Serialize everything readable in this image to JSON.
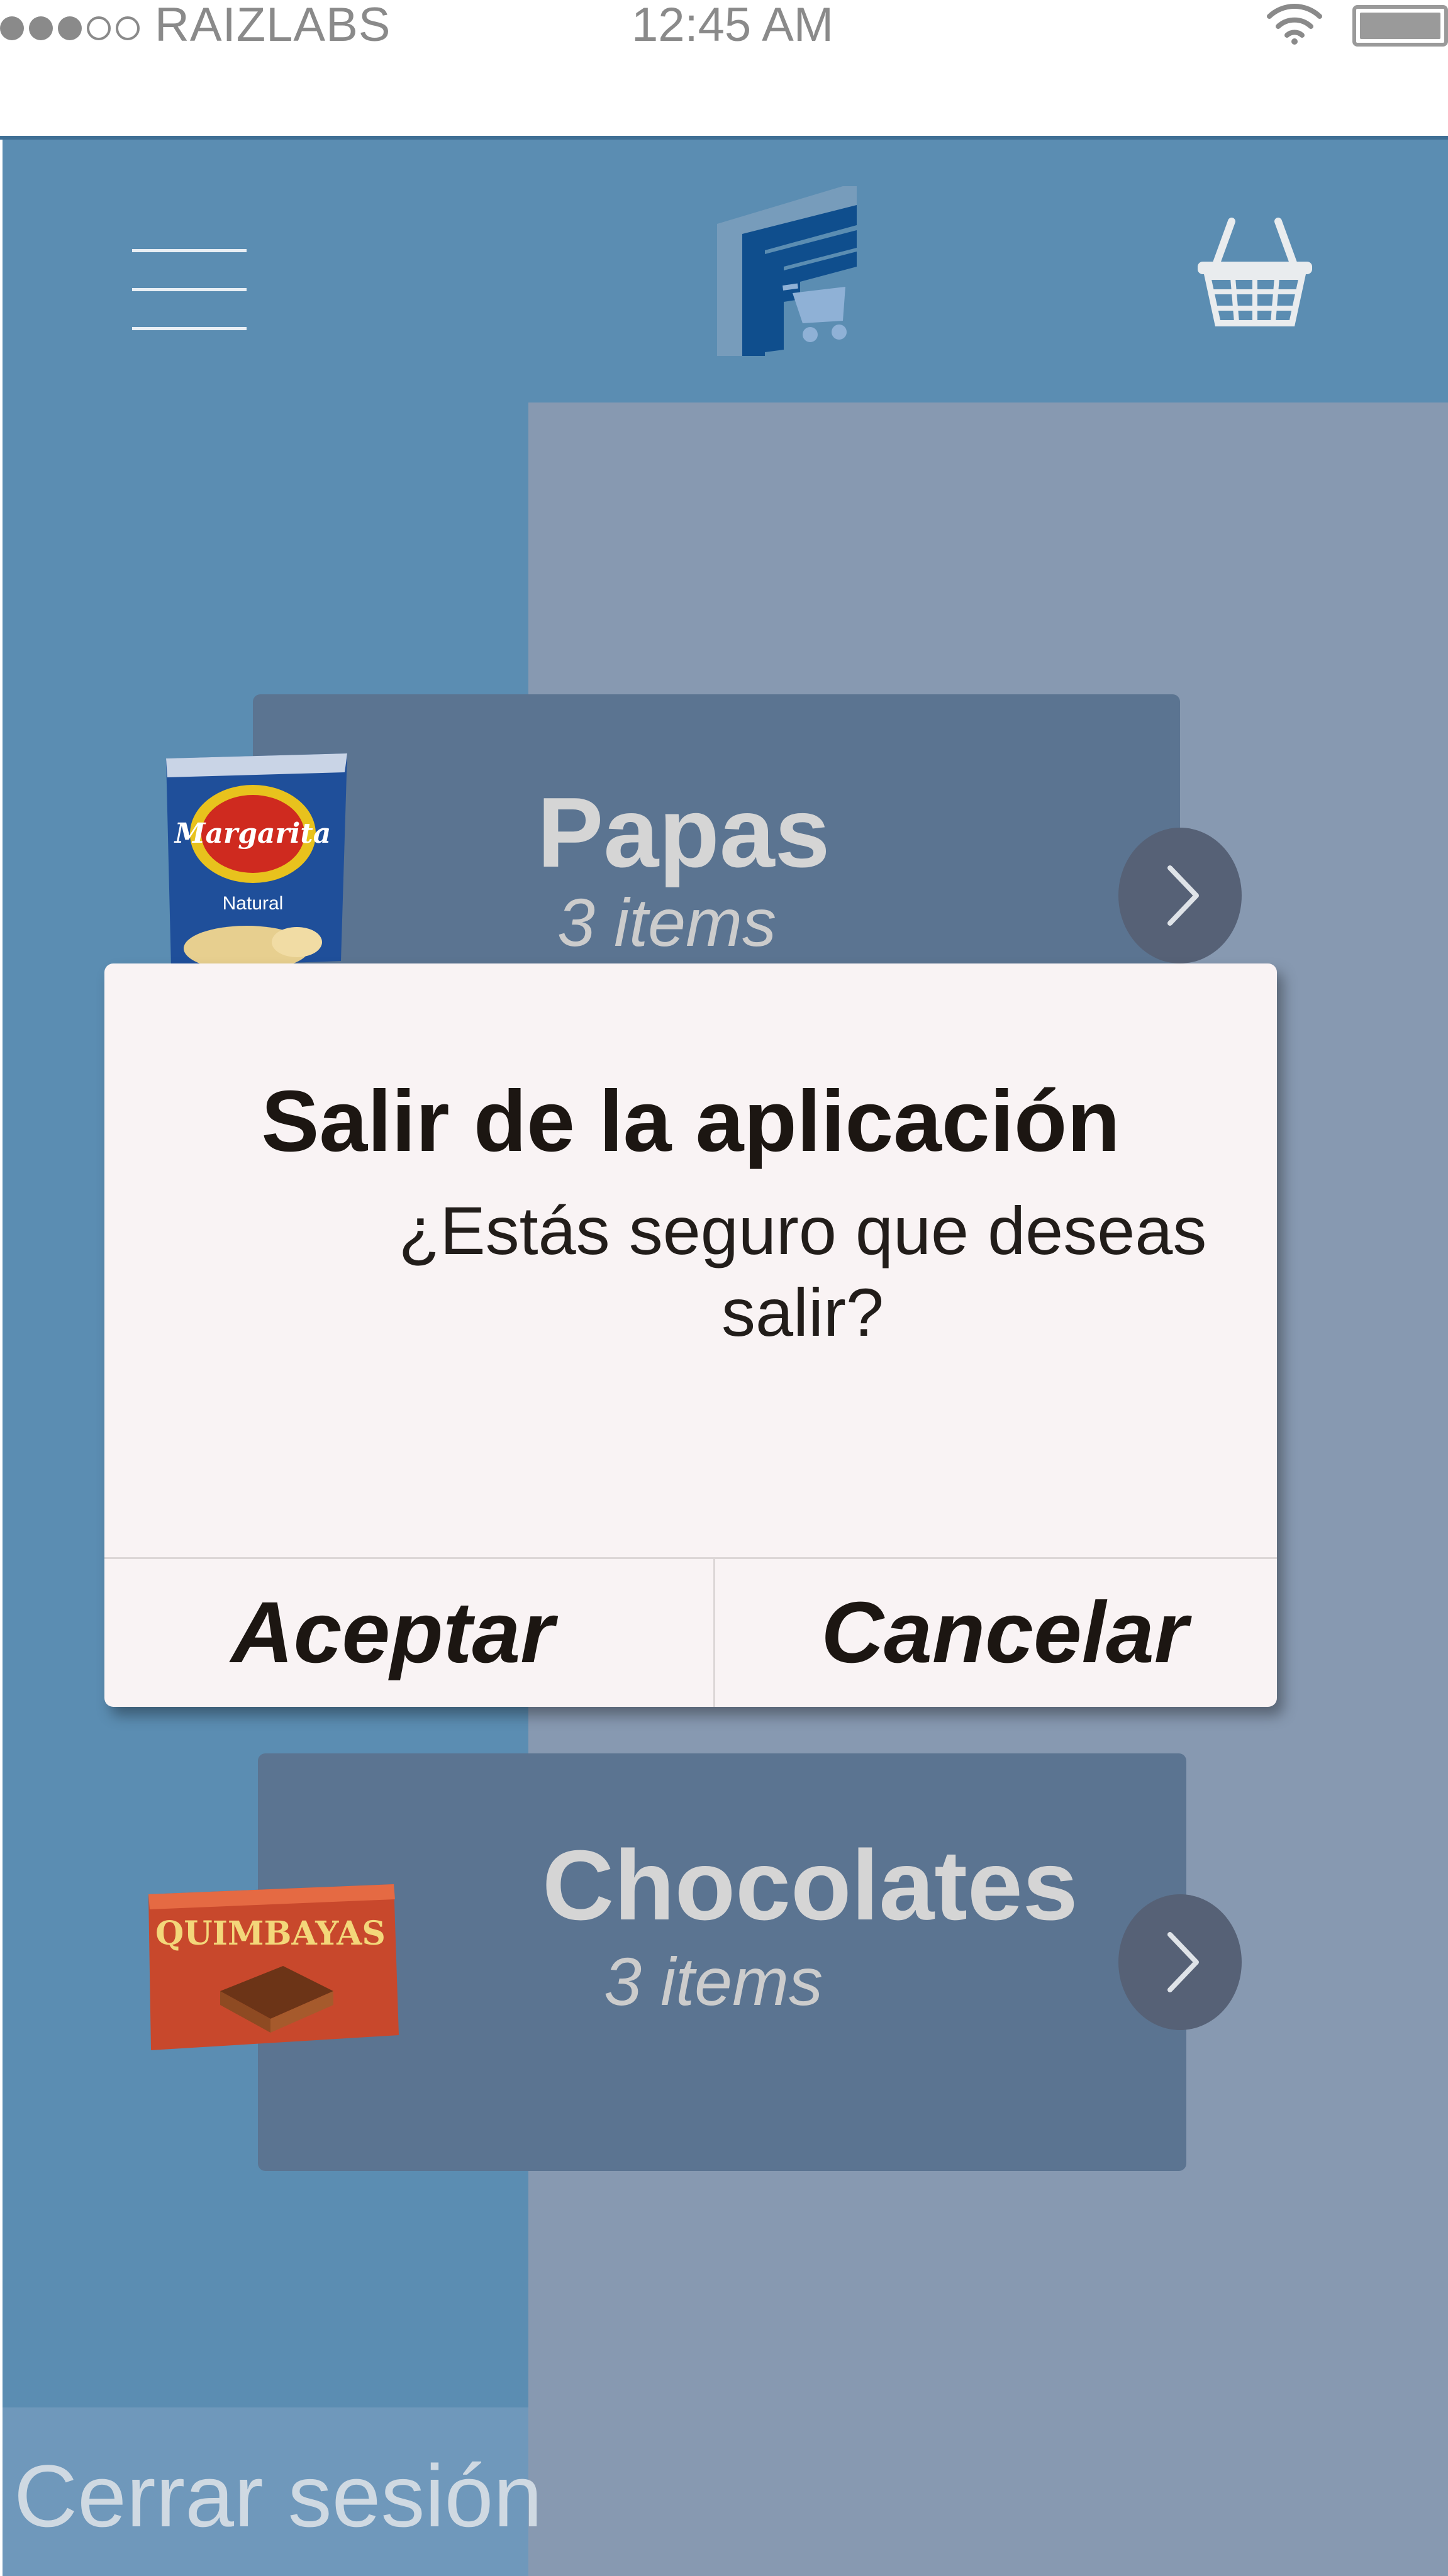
{
  "status_bar": {
    "carrier": "RAIZLABS",
    "time": "12:45 AM",
    "signal_icon": "signal-dots",
    "wifi_icon": "wifi-icon",
    "battery_icon": "battery-icon"
  },
  "header": {
    "menu_icon": "hamburger-menu-icon",
    "logo_icon": "store-cart-logo",
    "cart_icon": "shopping-basket-icon"
  },
  "categories": [
    {
      "title": "Papas",
      "subtitle": "3 items",
      "image": "margarita-chips-bag",
      "arrow_icon": "chevron-right-icon"
    },
    {
      "title": "Chocolates",
      "subtitle": "3 items",
      "image": "quimbayas-chocolate-bar",
      "arrow_icon": "chevron-right-icon"
    }
  ],
  "sidebar": {
    "logout_label": "Cerrar sesión"
  },
  "modal": {
    "title": "Salir de la aplicación",
    "message": "¿Estás seguro que deseas salir?",
    "accept_label": "Aceptar",
    "cancel_label": "Cancelar"
  },
  "colors": {
    "header_blue": "#5b8db2",
    "content_gray": "#8799b1",
    "card": "#5b7491",
    "modal_bg": "#f9f3f4"
  }
}
